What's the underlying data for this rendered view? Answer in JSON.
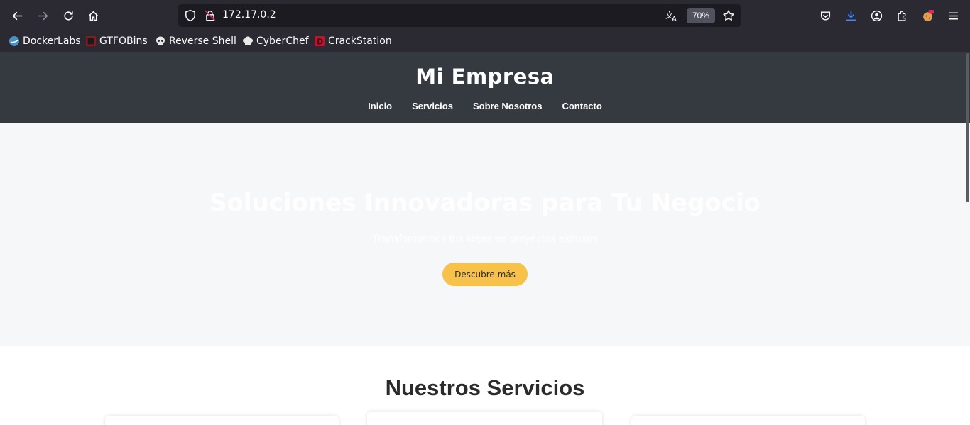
{
  "browser": {
    "url": "172.17.0.2",
    "zoom": "70%",
    "bookmarks": [
      {
        "label": "DockerLabs",
        "icon": "dockerlabs-icon"
      },
      {
        "label": "GTFOBins",
        "icon": "gtfobins-icon"
      },
      {
        "label": "Reverse Shell",
        "icon": "skull-icon"
      },
      {
        "label": "CyberChef",
        "icon": "chef-hat-icon"
      },
      {
        "label": "CrackStation",
        "icon": "crackstation-icon"
      }
    ]
  },
  "site": {
    "title": "Mi Empresa",
    "nav": [
      "Inicio",
      "Servicios",
      "Sobre Nosotros",
      "Contacto"
    ],
    "hero": {
      "title": "Soluciones Innovadoras para Tu Negocio",
      "subtitle": "Transformamos tus ideas en proyectos exitosos",
      "button": "Descubre más"
    },
    "services_title": "Nuestros Servicios"
  },
  "colors": {
    "chrome_bg": "#2b2a33",
    "header_bg": "#343a40",
    "hero_bg": "#f6f7f9",
    "accent": "#f8c14a"
  }
}
